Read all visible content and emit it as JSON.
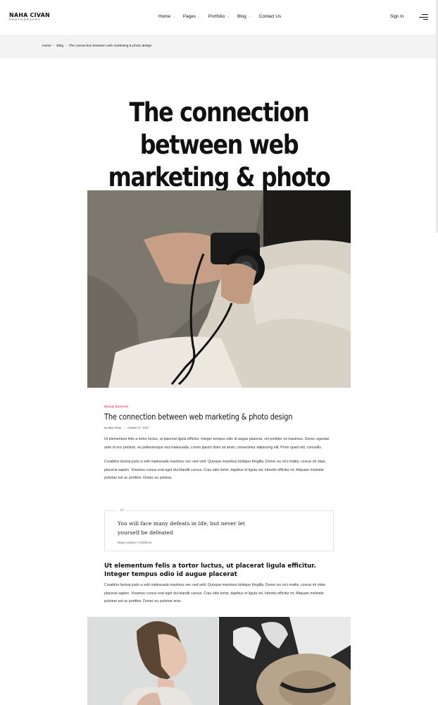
{
  "header": {
    "logo_main": "NAHA CIVAN",
    "logo_sub": "PHOTOGRAPHY",
    "nav": [
      {
        "label": "Home",
        "has_dropdown": true
      },
      {
        "label": "Pages",
        "has_dropdown": true
      },
      {
        "label": "Portfolio",
        "has_dropdown": true
      },
      {
        "label": "Blog",
        "has_dropdown": true
      },
      {
        "label": "Contact Us",
        "has_dropdown": false
      }
    ],
    "dropdown_icon": "chevron-down-icon",
    "sign_in": "Sign In",
    "menu_icon": "hamburger-menu-icon"
  },
  "breadcrumb": {
    "items": [
      "Home",
      "Blog",
      "The connection between web marketing & photo design"
    ],
    "separator": "›"
  },
  "hero": {
    "title": "The connection between web marketing & photo design",
    "image": "hands-holding-camera-photo"
  },
  "article": {
    "category": "Beauty Business",
    "title": "The connection between web marketing & photo design",
    "author": "by Alisa Torey",
    "date": "October 27, 2022",
    "paragraph1": "Ut elementum felis a tortor luctus, ut placerat ligula efficitur. Integer tempus odio id augue placerat, vel porttitor mi maximus. Donec egestas ante id orci pretium, eu pellentesque nisi malesuada. Lorem ipsum dolor sit amet, consectetur adipiscing elit. Proin quam elit, convallis.",
    "paragraph2": "Curabitur lacinia justo a velit malesuada maximus nec sed velit. Quisque maximus tristique fringilla. Donec eu orci mattis, cursus mi vitae, placerat sapien. Vivamus cursus erat eget dui blandit cursus. Cras odio tortor, dapibus et ligula vel, lobortis efficitur mi. Aliquam molestie pulvinar est ac porttitor. Donec eu pulvina.",
    "quote": {
      "text": "You will face many defeats in life, but never let yourself be defeated",
      "cite": "Maya Angelou • California",
      "icon": "quote-icon"
    },
    "subheading": "Ut elementum felis a tortor luctus, ut placerat ligula efficitur. Integer tempus odio id augue placerat",
    "paragraph3": "Curabitur lacinia justo a velit malesuada maximus nec sed velit. Quisque maximus tristique fringilla. Donec eu orci mattis, cursus mi vitae, placerat sapien. Vivamus cursus erat eget dui blandit cursus. Cras odio tortor, dapibus et ligula vel, lobortis efficitur mi. Aliquam molestie pulvinar est ac porttitor. Donec eu pulvinar eros.",
    "gallery": [
      "woman-portrait-photo",
      "hat-and-sandals-photo"
    ]
  },
  "colors": {
    "accent": "#e0243c",
    "breadcrumb_bg": "#f3f3f3",
    "text": "#111111"
  }
}
